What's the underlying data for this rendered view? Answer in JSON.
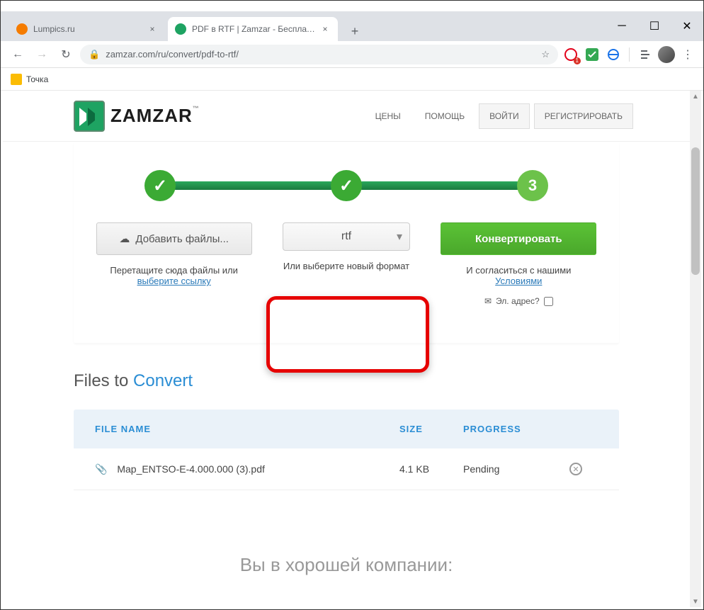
{
  "browser": {
    "tabs": [
      {
        "title": "Lumpics.ru",
        "active": false
      },
      {
        "title": "PDF в RTF | Zamzar - Бесплатная…",
        "active": true
      }
    ],
    "url": "zamzar.com/ru/convert/pdf-to-rtf/",
    "bookmark": "Точка",
    "ext_badge": "1"
  },
  "header": {
    "brand": "ZAMZAR",
    "nav": {
      "prices": "ЦЕНЫ",
      "help": "ПОМОЩЬ",
      "login": "ВОЙТИ",
      "register": "РЕГИСТРИРОВАТЬ"
    }
  },
  "converter": {
    "step3": "3",
    "add_files": "Добавить файлы...",
    "drag_hint": "Перетащите сюда файлы или",
    "choose_link": "выберите ссылку",
    "format": "rtf",
    "format_hint": "Или выберите новый формат",
    "convert": "Конвертировать",
    "agree": "И согласиться с нашими",
    "terms": "Условиями",
    "email_label": "Эл. адрес?"
  },
  "files": {
    "title_pre": "Files to ",
    "title_accent": "Convert",
    "cols": {
      "name": "FILE NAME",
      "size": "SIZE",
      "progress": "PROGRESS"
    },
    "row": {
      "name": "Map_ENTSO-E-4.000.000 (3).pdf",
      "size": "4.1 KB",
      "progress": "Pending"
    }
  },
  "footer_line": "Вы в хорошей компании:"
}
